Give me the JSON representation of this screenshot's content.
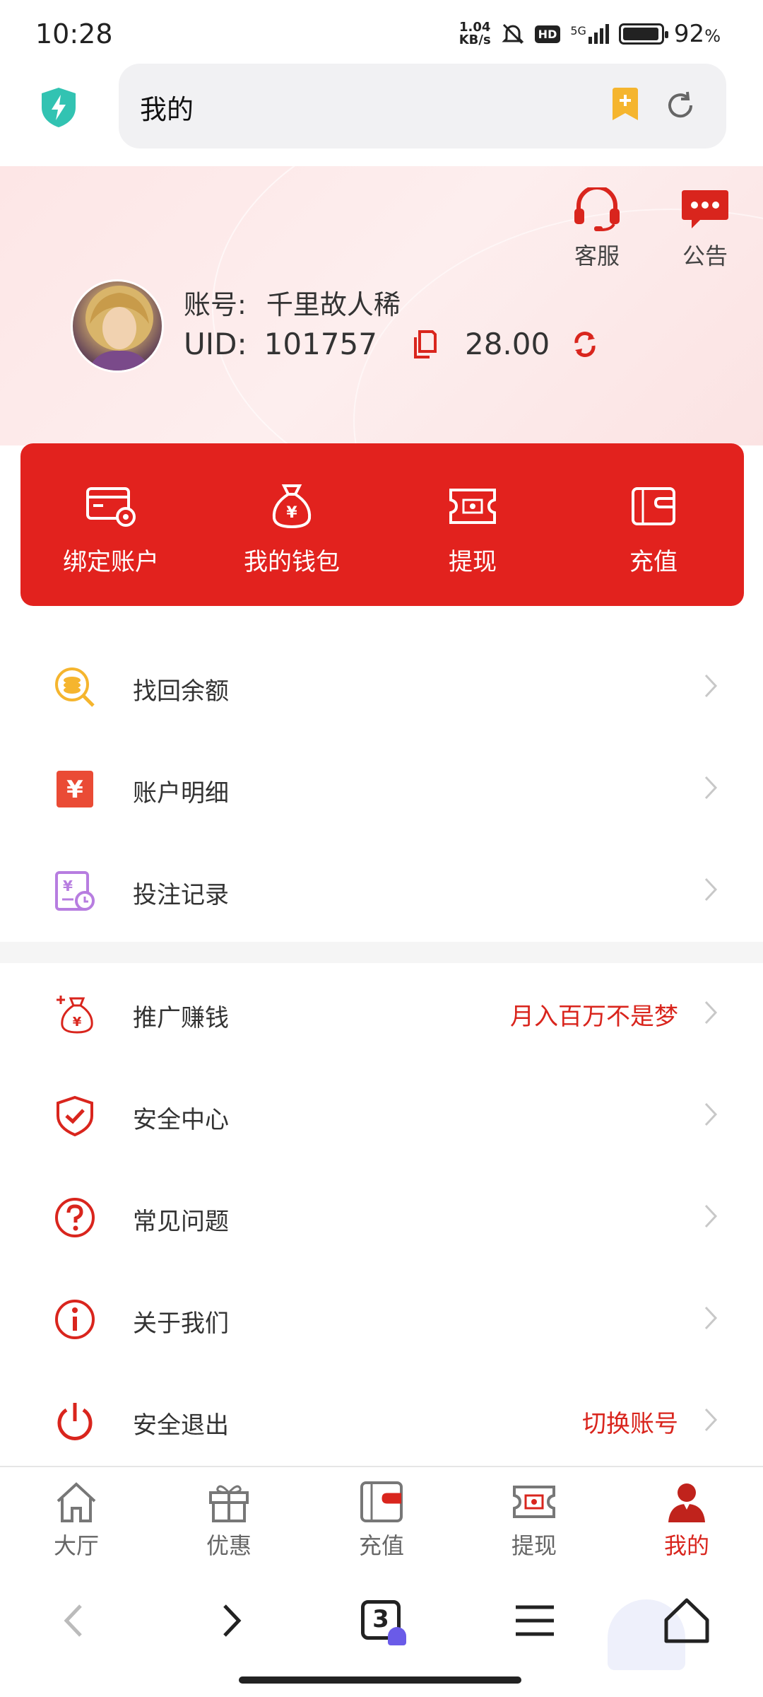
{
  "status_bar": {
    "time": "10:28",
    "net_speed_value": "1.04",
    "net_speed_unit": "KB/s",
    "hd": "HD",
    "signal": "5G",
    "battery_percent": "92",
    "battery_unit": "%"
  },
  "address_bar": {
    "text": "我的"
  },
  "header": {
    "service_label": "客服",
    "notice_label": "公告",
    "account_label": "账号:",
    "account_value": "千里故人稀",
    "uid_label": "UID:",
    "uid_value": "101757",
    "balance": "28.00"
  },
  "actions": [
    {
      "label": "绑定账户",
      "icon": "card-gear-icon"
    },
    {
      "label": "我的钱包",
      "icon": "money-bag-icon"
    },
    {
      "label": "提现",
      "icon": "cash-ticket-icon"
    },
    {
      "label": "充值",
      "icon": "wallet-icon"
    }
  ],
  "menu_group1": [
    {
      "label": "找回余额",
      "icon": "coin-search-icon"
    },
    {
      "label": "账户明细",
      "icon": "yuan-doc-icon"
    },
    {
      "label": "投注记录",
      "icon": "bet-record-icon"
    }
  ],
  "menu_group2": [
    {
      "label": "推广赚钱",
      "extra": "月入百万不是梦",
      "icon": "money-bag-plus-icon"
    },
    {
      "label": "安全中心",
      "extra": "",
      "icon": "shield-check-icon"
    },
    {
      "label": "常见问题",
      "extra": "",
      "icon": "question-circle-icon"
    },
    {
      "label": "关于我们",
      "extra": "",
      "icon": "info-circle-icon"
    },
    {
      "label": "安全退出",
      "extra": "切换账号",
      "icon": "power-icon"
    }
  ],
  "tabs": [
    {
      "label": "大厅",
      "icon": "home-icon"
    },
    {
      "label": "优惠",
      "icon": "gift-icon"
    },
    {
      "label": "充值",
      "icon": "wallet-icon"
    },
    {
      "label": "提现",
      "icon": "cash-ticket-icon"
    },
    {
      "label": "我的",
      "icon": "user-icon",
      "active": true
    }
  ],
  "browser_nav": {
    "tab_count": "3"
  },
  "colors": {
    "accent": "#e2221e",
    "header_bg": "#fde6e6",
    "extra_text": "#d9251d"
  }
}
